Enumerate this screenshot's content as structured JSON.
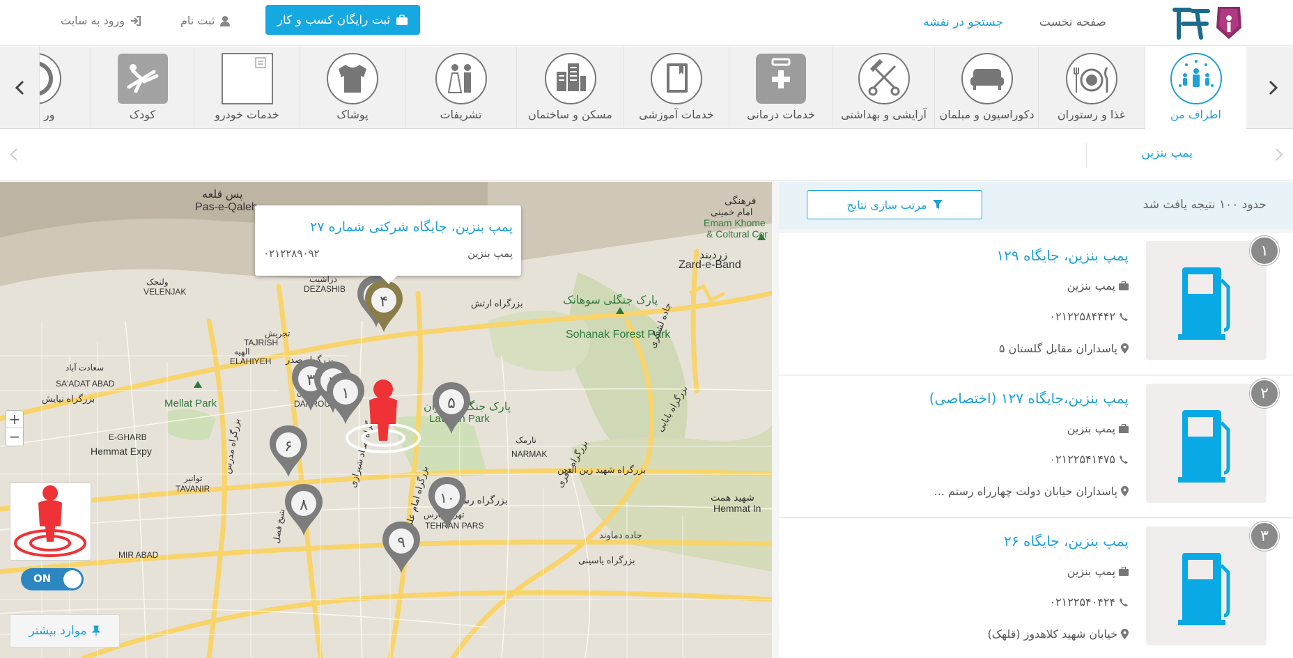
{
  "header": {
    "nav_home": "صفحه نخست",
    "nav_map_search": "جستجو در نقشه",
    "register_business": "ثبت رایگان کسب و کار",
    "signup": "ثبت نام",
    "login": "ورود به سایت"
  },
  "categories": [
    {
      "label": "اطراف من",
      "icon": "people-around-icon"
    },
    {
      "label": "غذا و رستوران",
      "icon": "plate-cutlery-icon"
    },
    {
      "label": "دکوراسیون و مبلمان",
      "icon": "sofa-icon"
    },
    {
      "label": "آرایشی و بهداشتی",
      "icon": "scissors-comb-icon"
    },
    {
      "label": "خدمات درمانی",
      "icon": "first-aid-kit-icon"
    },
    {
      "label": "خدمات آموزشی",
      "icon": "book-icon"
    },
    {
      "label": "مسکن و ساختمان",
      "icon": "buildings-icon"
    },
    {
      "label": "تشریفات",
      "icon": "bride-groom-icon"
    },
    {
      "label": "پوشاک",
      "icon": "shirt-icon"
    },
    {
      "label": "خدمات خودرو",
      "icon": "car-service-icon"
    },
    {
      "label": "کودک",
      "icon": "swing-icon"
    },
    {
      "label": "ور",
      "icon": "ball-icon"
    }
  ],
  "breadcrumb": {
    "current": "پمپ بنزین"
  },
  "map": {
    "popup": {
      "title": "پمپ بنزین، جایگاه شرکتی شماره ۲۷",
      "category": "پمپ بنزین",
      "phone": "۰۲۱۲۲۸۹۰۹۲"
    },
    "labels": {
      "pas_e_qaleh": "Pas-e-Qaleh",
      "pas_e_qaleh_fa": "پس قلعه",
      "zard_e_band": "Zard-e-Band",
      "zard_e_band_fa": "زردبند",
      "emam_khomeini": "Emam Khome",
      "cultural": "& Coltural Cor",
      "cultural_fa": "فرهنگی",
      "imam_khomeini_fa": "امام خمینی",
      "velenjak": "VELENJAK",
      "velenjak_fa": "ولنجک",
      "dezashib": "DEZASHIB",
      "dezashib_fa": "دزاشیب",
      "tajrish": "TAJRISH",
      "tajrish_fa": "تجریش",
      "elahiyeh": "ELAHIYEH",
      "elahiyeh_fa": "الهیه",
      "saadat_abad": "SA'ADAT ABAD",
      "saadat_abad_fa": "سعادت آباد",
      "mellat_park": "Mellat Park",
      "darrous": "DARROUS",
      "darrous_fa": "دروس",
      "lavizan_park": "Lavizan Park",
      "lavizan_park_fa": "پارک جنگلی لویزان",
      "sohanak_park": "Sohanak Forest Park",
      "sohanak_park_fa": "پارک جنگلی سوهانک",
      "narmak": "NARMAK",
      "narmak_fa": "نارمک",
      "tavanir": "TAVANIR",
      "tavanir_fa": "توانیر",
      "hemmat_expy": "Hemmat Expy",
      "hemmat_in": "Hemmat In",
      "hemmat_fa": "شهید همت",
      "tehran_pars": "TEHRAN PARS",
      "tehran_pars_fa": "تهران پارس",
      "e_gharb": "E-GHARB",
      "mir_abad": "MIR ABAD",
      "resalat_fa": "بزرگراه رسالت",
      "babaei_fa": "بزرگراه بابایی",
      "artesh_fa": "بزرگراه ارتش",
      "sadr_fa": "بزرگراه صدر",
      "niayesh_fa": "بزرگراه نیایش",
      "zeynoddin_fa": "بزرگراه شهید زین الدین",
      "lashgari_fa": "جاده لشگری",
      "sayad_fa": "بزرگراه صیاد شیرازی",
      "imam_ali_fa": "بزرگراه امام علی",
      "baghri_fa": "بزرگراه باقری",
      "yasini_fa": "بزرگراه یاسینی",
      "modares_fa": "بزرگراه مدرس",
      "sheikh_fazl_fa": "شیخ فضل",
      "damavand_fa": "جاده دماوند"
    },
    "markers": [
      "۱",
      "۲",
      "۳",
      "۴",
      "۵",
      "۶",
      "۷",
      "۸",
      "۹",
      "۱۰"
    ],
    "toggle": "ON",
    "more_button": "موارد بیشتر"
  },
  "results": {
    "found_text": "حدود ۱۰۰ نتیجه یافت شد",
    "sort_label": "مرتب سازی نتایج",
    "items": [
      {
        "num": "۱",
        "title": "پمپ بنزین، جایگاه ۱۲۹",
        "category": "پمپ بنزین",
        "phone": "۰۲۱۲۲۵۸۴۴۴۲",
        "address": "پاسداران مقابل گلستان ۵"
      },
      {
        "num": "۲",
        "title": "پمپ بنزین،جایگاه ۱۲۷ (اختصاصی)",
        "category": "پمپ بنزین",
        "phone": "۰۲۱۲۲۵۴۱۴۷۵",
        "address": "پاسداران خیابان دولت چهارراه رستم ..."
      },
      {
        "num": "۳",
        "title": "پمپ بنزین، جایگاه ۲۶",
        "category": "پمپ بنزین",
        "phone": "۰۲۱۲۲۵۴۰۴۲۴",
        "address": "خیابان شهید کلاهدوز (قلهک)"
      }
    ]
  },
  "colors": {
    "accent": "#1da1d6",
    "marker": "#7d7d7d",
    "person": "#ee3236"
  }
}
